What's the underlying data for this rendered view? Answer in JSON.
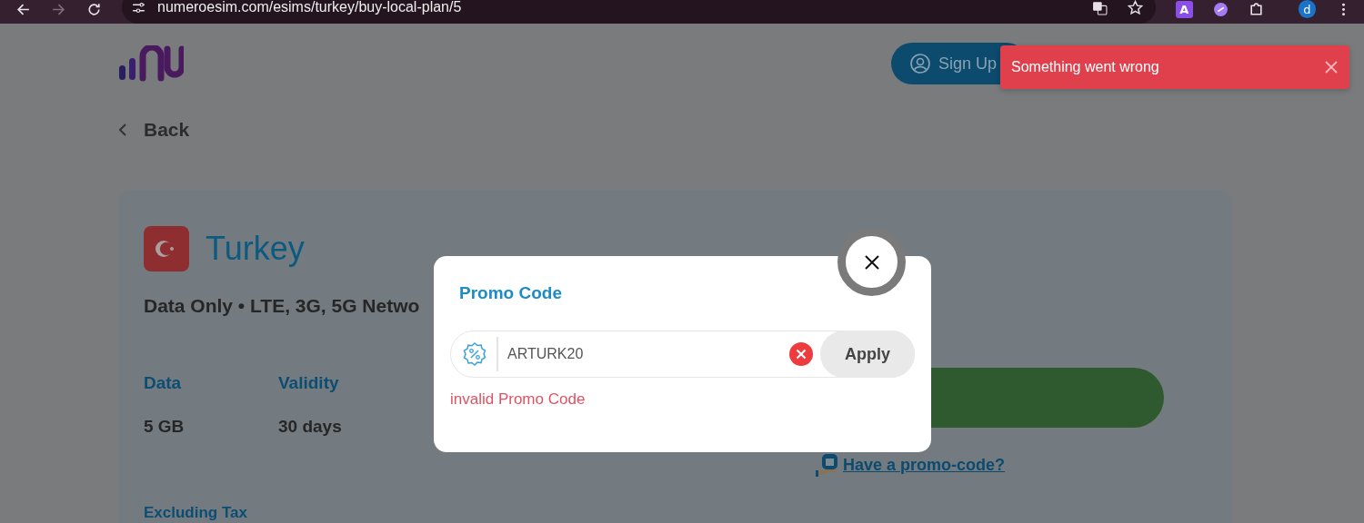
{
  "browser": {
    "url": "numeroesim.com/esims/turkey/buy-local-plan/5",
    "extension_label": "A",
    "profile_initial": "d"
  },
  "header": {
    "sign_up": "Sign Up"
  },
  "toast": {
    "message": "Something went wrong"
  },
  "back": "Back",
  "plan": {
    "country": "Turkey",
    "subtitle": "Data Only • LTE, 3G, 5G Netwo",
    "specs": [
      {
        "label": "Data",
        "value": "5 GB"
      },
      {
        "label": "Validity",
        "value": "30 days"
      }
    ],
    "tax_note": "Excluding Tax",
    "promo_link": "Have a promo-code?"
  },
  "modal": {
    "title": "Promo Code",
    "code": "ARTURK20",
    "apply": "Apply",
    "error": "invalid Promo Code"
  }
}
